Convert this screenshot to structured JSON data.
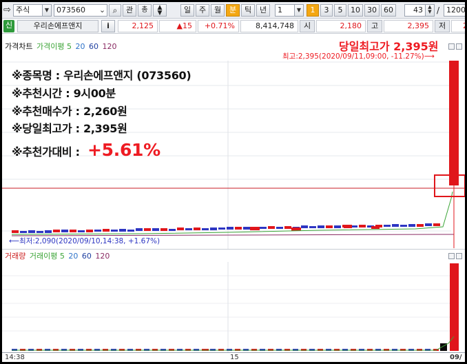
{
  "toolbar": {
    "market_type": "주식",
    "stock_code": "073560",
    "btn_gwan": "관",
    "btn_ja": "총",
    "period_buttons": [
      "일",
      "주",
      "월",
      "분",
      "틱",
      "년"
    ],
    "active_period": "분",
    "period_value": "1",
    "interval_buttons": [
      "1",
      "3",
      "5",
      "10",
      "30",
      "60"
    ],
    "active_interval": "1",
    "count_value": "43",
    "slash": "/",
    "total_value": "1200"
  },
  "quote_bar": {
    "badge": "신",
    "stock_name": "우리손에프앤지",
    "info_btn": "i",
    "price": "2,125",
    "change": "▲15",
    "change_pct": "+0.71%",
    "volume": "8,414,748",
    "open_label": "시",
    "open_value": "2,180",
    "high_label": "고",
    "high_value": "2,395",
    "low_label": "저",
    "low_value": "2"
  },
  "price_pane": {
    "legend": [
      {
        "text": "가격차트",
        "color": "#cc1f1f"
      },
      {
        "text": "가격이평 5",
        "color": "#3ba436"
      },
      {
        "text": "20",
        "color": "#2e73c9"
      },
      {
        "text": "60",
        "color": "#1f3fa0"
      },
      {
        "text": "120",
        "color": "#8a2b63"
      }
    ],
    "headline": "당일최고가 2,395원",
    "high_note": "최고:2,395(2020/09/11,09:00, -11.27%)⟶",
    "low_note": "⟵최저:2,090(2020/09/10,14:38, +1.67%)"
  },
  "info_box": {
    "name_line": "※종목명 : 우리손에프앤지 (073560)",
    "time_line": "※추천시간 : 9시00분",
    "buy_line": "※추천매수가 : 2,260원",
    "high_line": "※당일최고가 : 2,395원",
    "ratio_label": "※추천가대비 :",
    "ratio_value": "+5.61%"
  },
  "volume_pane": {
    "legend": [
      {
        "text": "거래량",
        "color": "#cc1f1f"
      },
      {
        "text": "거래이평 5",
        "color": "#3ba436"
      },
      {
        "text": "20",
        "color": "#2e73c9"
      },
      {
        "text": "60",
        "color": "#1f3fa0"
      },
      {
        "text": "120",
        "color": "#8a2b63"
      }
    ]
  },
  "time_axis": {
    "labels": [
      "14:38",
      "15",
      "09/"
    ]
  },
  "colors": {
    "up": "#e0161b",
    "down": "#2d35c2",
    "ma5": "#3ba436",
    "accent": "#f4a712"
  }
}
